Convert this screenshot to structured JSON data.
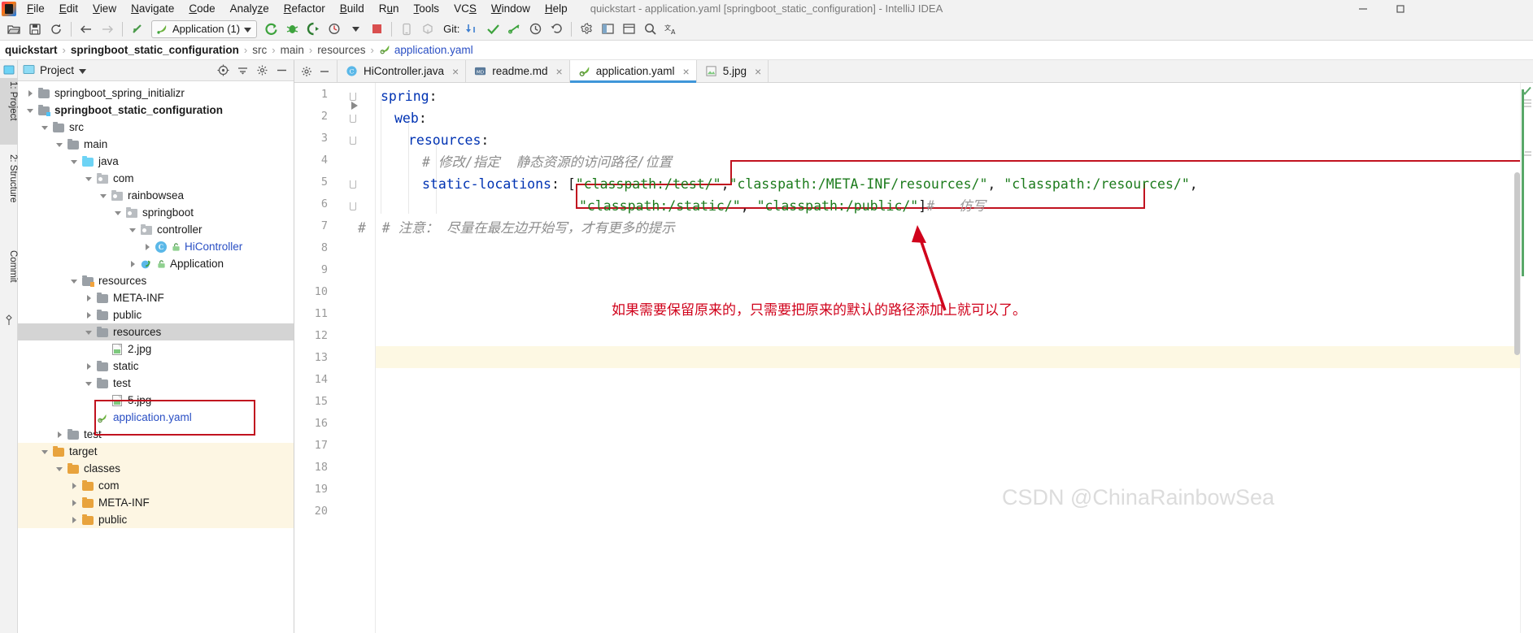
{
  "window": {
    "title": "quickstart - application.yaml [springboot_static_configuration] - IntelliJ IDEA",
    "minimize_label": "—",
    "maximize_label": "❐"
  },
  "menubar": [
    {
      "label": "File",
      "accel": "F"
    },
    {
      "label": "Edit",
      "accel": "E"
    },
    {
      "label": "View",
      "accel": "V"
    },
    {
      "label": "Navigate",
      "accel": "N"
    },
    {
      "label": "Code",
      "accel": "C"
    },
    {
      "label": "Analyze",
      "accel": "z"
    },
    {
      "label": "Refactor",
      "accel": "R"
    },
    {
      "label": "Build",
      "accel": "B"
    },
    {
      "label": "Run",
      "accel": "u"
    },
    {
      "label": "Tools",
      "accel": "T"
    },
    {
      "label": "VCS",
      "accel": "S"
    },
    {
      "label": "Window",
      "accel": "W"
    },
    {
      "label": "Help",
      "accel": "H"
    }
  ],
  "toolbar": {
    "open_label": "Open",
    "save_label": "Save All",
    "sync_label": "Synchronize",
    "back_label": "Back",
    "forward_label": "Forward",
    "revert_label": "Revert",
    "run_config_name": "Application (1)",
    "run_label": "Run",
    "debug_label": "Debug",
    "run_coverage_label": "Run with Coverage",
    "profile_label": "Profile",
    "stop_label": "Stop",
    "device_label": "Device Manager",
    "sdk_label": "SDK Manager",
    "git_label": "Git:",
    "update_project_label": "Update Project",
    "commit_label": "Commit",
    "push_label": "Push",
    "history_label": "History",
    "rollback_label": "Rollback",
    "settings_label": "Settings",
    "layout_label": "Layout",
    "project_structure_label": "Project Structure",
    "search_label": "Search Everywhere",
    "translate_label": "Translate"
  },
  "breadcrumb": [
    {
      "label": "quickstart",
      "style": "bold"
    },
    {
      "label": "springboot_static_configuration",
      "style": "bold"
    },
    {
      "label": "src",
      "style": "muted"
    },
    {
      "label": "main",
      "style": "muted"
    },
    {
      "label": "resources",
      "style": "muted"
    },
    {
      "label": "application.yaml",
      "style": "link",
      "icon": "yaml-spring-icon"
    }
  ],
  "left_rail": [
    {
      "label": "1: Project",
      "selected": true
    },
    {
      "label": "2: Structure",
      "selected": false
    },
    {
      "label": "Commit",
      "selected": false
    },
    {
      "label": "",
      "selected": false
    }
  ],
  "project_panel": {
    "title": "Project",
    "actions": [
      "target-icon",
      "collapse-all-icon",
      "settings-icon",
      "hide-icon"
    ],
    "tree": [
      {
        "label": "springboot_spring_initializr",
        "depth": 1,
        "twisty": "right",
        "icon": "folder",
        "style": "dark"
      },
      {
        "label": "springboot_static_configuration",
        "depth": 1,
        "twisty": "down",
        "icon": "folder-module",
        "style": "bold"
      },
      {
        "label": "src",
        "depth": 2,
        "twisty": "down",
        "icon": "folder",
        "style": "dark"
      },
      {
        "label": "main",
        "depth": 3,
        "twisty": "down",
        "icon": "folder",
        "style": "dark"
      },
      {
        "label": "java",
        "depth": 4,
        "twisty": "down",
        "icon": "folder-source",
        "style": "dark"
      },
      {
        "label": "com",
        "depth": 5,
        "twisty": "down",
        "icon": "package",
        "style": "dark"
      },
      {
        "label": "rainbowsea",
        "depth": 6,
        "twisty": "down",
        "icon": "package",
        "style": "dark"
      },
      {
        "label": "springboot",
        "depth": 7,
        "twisty": "down",
        "icon": "package",
        "style": "dark"
      },
      {
        "label": "controller",
        "depth": 8,
        "twisty": "down",
        "icon": "package",
        "style": "dark"
      },
      {
        "label": "HiController",
        "depth": 9,
        "twisty": "right",
        "icon": "class-lock",
        "style": "blue"
      },
      {
        "label": "Application",
        "depth": 8,
        "twisty": "right",
        "icon": "spring-class-lock",
        "style": "dark"
      },
      {
        "label": "resources",
        "depth": 4,
        "twisty": "down",
        "icon": "folder-resource",
        "style": "dark"
      },
      {
        "label": "META-INF",
        "depth": 5,
        "twisty": "right",
        "icon": "folder",
        "style": "dark"
      },
      {
        "label": "public",
        "depth": 5,
        "twisty": "right",
        "icon": "folder",
        "style": "dark"
      },
      {
        "label": "resources",
        "depth": 5,
        "twisty": "down",
        "icon": "folder",
        "style": "dark",
        "selected": true
      },
      {
        "label": "2.jpg",
        "depth": 6,
        "twisty": "none",
        "icon": "image",
        "style": "dark"
      },
      {
        "label": "static",
        "depth": 5,
        "twisty": "right",
        "icon": "folder",
        "style": "dark"
      },
      {
        "label": "test",
        "depth": 5,
        "twisty": "down",
        "icon": "folder",
        "style": "dark"
      },
      {
        "label": "5.jpg",
        "depth": 6,
        "twisty": "none",
        "icon": "image",
        "style": "dark"
      },
      {
        "label": "application.yaml",
        "depth": 5,
        "twisty": "none",
        "icon": "yaml-spring",
        "style": "blue",
        "boxed": true
      },
      {
        "label": "test",
        "depth": 3,
        "twisty": "right",
        "icon": "folder",
        "style": "dark"
      },
      {
        "label": "target",
        "depth": 2,
        "twisty": "down",
        "icon": "folder-orange",
        "style": "dark",
        "excluded": true
      },
      {
        "label": "classes",
        "depth": 3,
        "twisty": "down",
        "icon": "folder-orange",
        "style": "dark",
        "excluded": true
      },
      {
        "label": "com",
        "depth": 4,
        "twisty": "right",
        "icon": "folder-orange",
        "style": "dark",
        "excluded": true
      },
      {
        "label": "META-INF",
        "depth": 4,
        "twisty": "right",
        "icon": "folder-orange",
        "style": "dark",
        "excluded": true
      },
      {
        "label": "public",
        "depth": 4,
        "twisty": "right",
        "icon": "folder-orange",
        "style": "dark",
        "excluded": true
      }
    ]
  },
  "editor_tabs": [
    {
      "label": "HiController.java",
      "icon": "java-class-icon",
      "active": false,
      "closable": true
    },
    {
      "label": "readme.md",
      "icon": "markdown-icon",
      "active": false,
      "closable": true
    },
    {
      "label": "application.yaml",
      "icon": "yaml-spring-icon",
      "active": true,
      "closable": true
    },
    {
      "label": "5.jpg",
      "icon": "image-icon",
      "active": false,
      "closable": true
    }
  ],
  "editor": {
    "file_name": "application.yaml",
    "line_numbers": [
      "1",
      "2",
      "3",
      "4",
      "5",
      "6",
      "7",
      "8",
      "9",
      "10",
      "11",
      "12",
      "13",
      "14",
      "15",
      "16",
      "17",
      "18",
      "19",
      "20"
    ],
    "caret_line": 13,
    "lines": [
      {
        "n": 1,
        "indent": 0,
        "segments": [
          {
            "t": "spring",
            "c": "key"
          },
          {
            "t": ":",
            "c": "punct"
          }
        ]
      },
      {
        "n": 2,
        "indent": 1,
        "segments": [
          {
            "t": "web",
            "c": "key"
          },
          {
            "t": ":",
            "c": "punct"
          }
        ]
      },
      {
        "n": 3,
        "indent": 2,
        "segments": [
          {
            "t": "resources",
            "c": "key"
          },
          {
            "t": ":",
            "c": "punct"
          }
        ]
      },
      {
        "n": 4,
        "indent": 3,
        "segments": [
          {
            "t": "# 修改/指定  静态资源的访问路径/位置",
            "c": "cmt"
          }
        ]
      },
      {
        "n": 5,
        "indent": 3,
        "segments": [
          {
            "t": "static-locations",
            "c": "key"
          },
          {
            "t": ": [",
            "c": "punct"
          },
          {
            "t": "\"classpath:/test/\"",
            "c": "str"
          },
          {
            "t": ",",
            "c": "punct"
          },
          {
            "t": "\"classpath:/META-INF/resources/\"",
            "c": "str"
          },
          {
            "t": ", ",
            "c": "punct"
          },
          {
            "t": "\"classpath:/resources/\"",
            "c": "str"
          },
          {
            "t": ",",
            "c": "punct"
          }
        ]
      },
      {
        "n": 6,
        "indent": 0,
        "segments": [
          {
            "t": "\"classpath:/static/\"",
            "c": "str"
          },
          {
            "t": ", ",
            "c": "punct"
          },
          {
            "t": "\"classpath:/public/\"",
            "c": "str"
          },
          {
            "t": "]",
            "c": "punct"
          },
          {
            "t": "#",
            "c": "cmt2"
          },
          {
            "t": "   仿写",
            "c": "cmt2"
          }
        ]
      },
      {
        "n": 7,
        "indent": 0,
        "segments": [
          {
            "t": "#  # 注意： 尽量在最左边开始写，才有更多的提示",
            "c": "cmt"
          }
        ]
      }
    ]
  },
  "annotations": {
    "red_note": "如果需要保留原来的，只需要把原来的默认的路径添加上就可以了。",
    "red_color": "#d0021b"
  },
  "watermark": {
    "text": "CSDN @ChinaRainbowSea",
    "color": "#dcdcdc"
  },
  "colors": {
    "accent_blue": "#3f96d9",
    "string_green": "#1c7b1c",
    "keyword_blue": "#0033b3",
    "annotation_red": "#c1121f",
    "selected_row": "#d4d4d4",
    "excluded_bg": "#fdf6e3"
  }
}
